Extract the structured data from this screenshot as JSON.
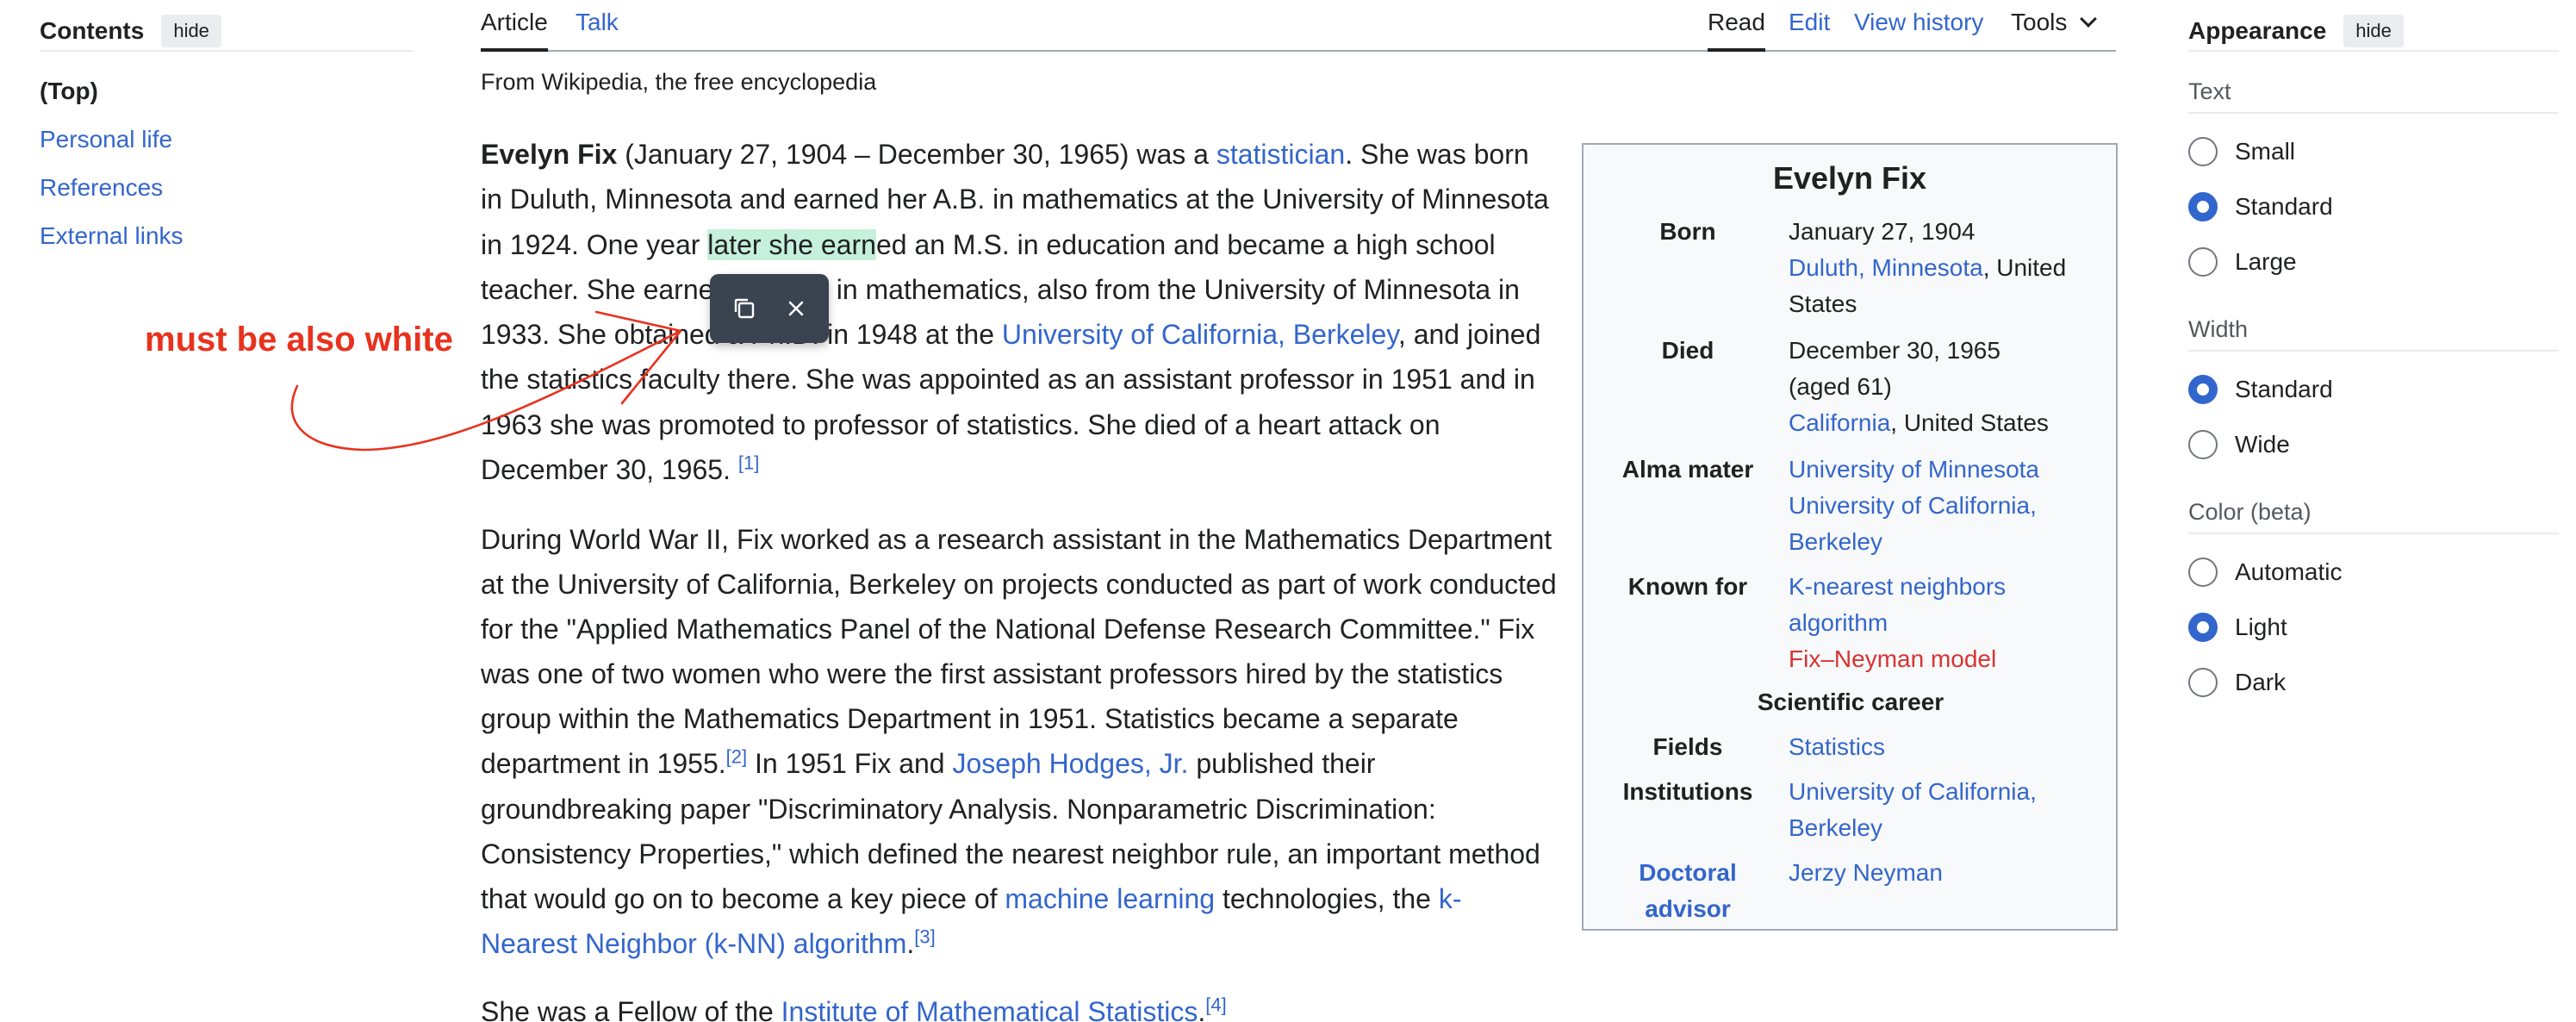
{
  "toc": {
    "title": "Contents",
    "hide_label": "hide",
    "items": [
      "(Top)",
      "Personal life",
      "References",
      "External links"
    ]
  },
  "tabs": {
    "article": "Article",
    "talk": "Talk",
    "read": "Read",
    "edit": "Edit",
    "view_history": "View history",
    "tools": "Tools"
  },
  "tagline": "From Wikipedia, the free encyclopedia",
  "annotation": {
    "text": "must be also white",
    "color": "#e8321e"
  },
  "popup": {
    "copy_icon": "copy-icon",
    "close_icon": "close-icon"
  },
  "infobox": {
    "title": "Evelyn Fix",
    "born_label": "Born",
    "born_date": "January 27, 1904",
    "born_place_link": "Duluth, Minnesota",
    "born_place_rest": ", United States",
    "died_label": "Died",
    "died_date": "December 30, 1965",
    "died_age": "(aged 61)",
    "died_place_link": "California",
    "died_place_rest": ", United States",
    "alma_label": "Alma mater",
    "alma_1": "University of Minnesota",
    "alma_2a": "University of California,",
    "alma_2b": "Berkeley",
    "known_label": "Known for",
    "known_1a": "K-nearest neighbors",
    "known_1b": "algorithm",
    "known_2": "Fix–Neyman model",
    "career_heading": "Scientific career",
    "fields_label": "Fields",
    "fields_value": "Statistics",
    "inst_label": "Institutions",
    "inst_a": "University of California,",
    "inst_b": "Berkeley",
    "advisor_label_a": "Doctoral",
    "advisor_label_b": "advisor",
    "advisor_value": "Jerzy Neyman"
  },
  "article": {
    "p1": {
      "name": "Evelyn Fix",
      "t1": " (January 27, 1904 – December 30, 1965) was a ",
      "statistician": "statistician",
      "t2": ". She was born in Duluth, Minnesota and earned her A.B. in mathematics at the University of Minnesota in 1924. One year ",
      "highlight": "later she earn",
      "t3": "ed an M.S. in education and became a high school teacher. She earned a Ph.D. in mathematics, also from the University of Minnesota in 1933. She obtained a Ph.D. in 1948 at the ",
      "ucb": "University of California, Berkeley",
      "t4": ", and joined the statistics faculty there. She was appointed as an assistant professor in 1951 and in 1963 she was promoted to professor of statistics. She died of a heart attack on December 30, 1965. ",
      "ref1": "[1]"
    },
    "p2": {
      "t1": "During World War II, Fix worked as a research assistant in the Mathematics Department at the University of California, Berkeley on projects conducted as part of work conducted for the \"Applied Mathematics Panel of the National Defense Research Committee.\" Fix was one of two women who were the first assistant professors hired by the statistics group within the Mathematics Department in 1951. Statistics became a separate department in 1955.",
      "ref2": "[2]",
      "t2": " In 1951 Fix and ",
      "hodges": "Joseph Hodges, Jr.",
      "t3": " published their groundbreaking paper \"Discriminatory Analysis. Nonparametric Discrimination: Consistency Properties,\" which defined the nearest neighbor rule, an important method that would go on to become a key piece of ",
      "ml": "machine learning",
      "t4": " technologies, the ",
      "knn": "k-Nearest Neighbor (k-NN) algorithm",
      "t5": ".",
      "ref3": "[3]"
    },
    "p3": {
      "t1": "She was a Fellow of the ",
      "ims": "Institute of Mathematical Statistics",
      "t2": ".",
      "ref4": "[4]"
    }
  },
  "appearance": {
    "title": "Appearance",
    "hide_label": "hide",
    "text_group": "Text",
    "text_options": [
      "Small",
      "Standard",
      "Large"
    ],
    "text_selected": "Standard",
    "width_group": "Width",
    "width_options": [
      "Standard",
      "Wide"
    ],
    "width_selected": "Standard",
    "color_group": "Color (beta)",
    "color_options": [
      "Automatic",
      "Light",
      "Dark"
    ],
    "color_selected": "Light"
  }
}
